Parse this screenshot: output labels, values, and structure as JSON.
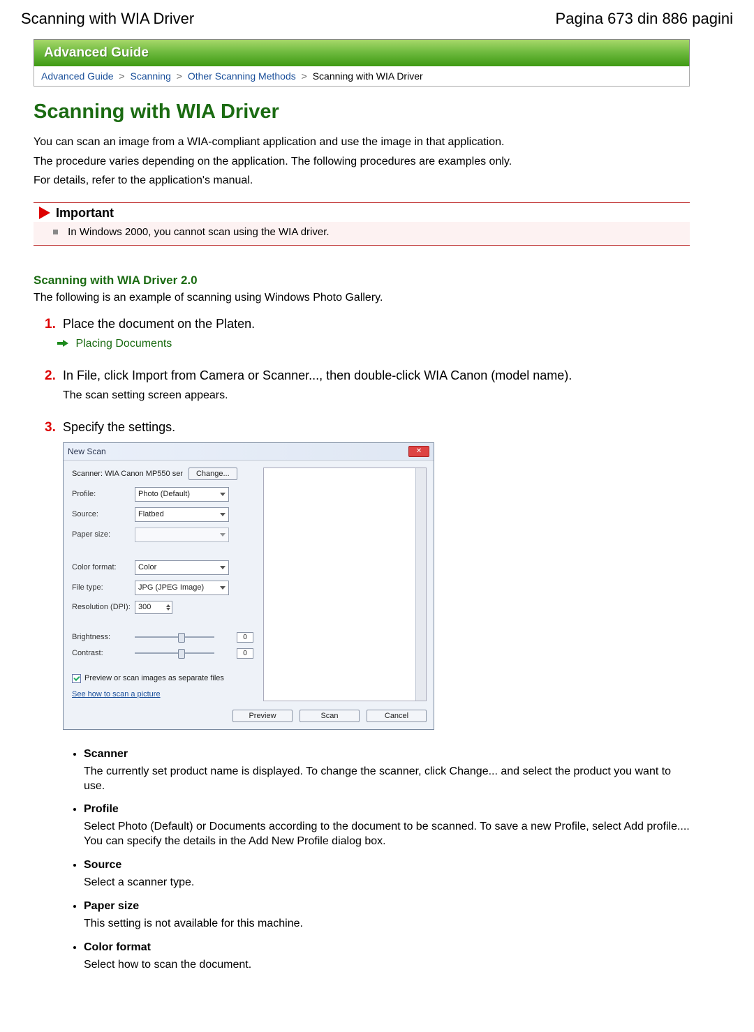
{
  "header": {
    "left": "Scanning with WIA Driver",
    "right": "Pagina 673 din 886 pagini"
  },
  "guide_bar": "Advanced Guide",
  "breadcrumb": {
    "items": [
      "Advanced Guide",
      "Scanning",
      "Other Scanning Methods"
    ],
    "current": "Scanning with WIA Driver",
    "sep": ">"
  },
  "title": "Scanning with WIA Driver",
  "intro": [
    "You can scan an image from a WIA-compliant application and use the image in that application.",
    "The procedure varies depending on the application. The following procedures are examples only.",
    "For details, refer to the application's manual."
  ],
  "important": {
    "heading": "Important",
    "text": "In Windows 2000, you cannot scan using the WIA driver."
  },
  "section": {
    "heading": "Scanning with WIA Driver 2.0",
    "text": "The following is an example of scanning using Windows Photo Gallery."
  },
  "steps": [
    {
      "num": "1.",
      "text": "Place the document on the Platen.",
      "link": "Placing Documents"
    },
    {
      "num": "2.",
      "text": "In File, click Import from Camera or Scanner..., then double-click WIA Canon (model name).",
      "sub": "The scan setting screen appears."
    },
    {
      "num": "3.",
      "text": "Specify the settings."
    }
  ],
  "dialog": {
    "title": "New Scan",
    "scanner_label": "Scanner: WIA Canon MP550 ser",
    "change": "Change...",
    "rows": {
      "profile": {
        "label": "Profile:",
        "value": "Photo (Default)"
      },
      "source": {
        "label": "Source:",
        "value": "Flatbed"
      },
      "paper": {
        "label": "Paper size:",
        "value": ""
      },
      "color": {
        "label": "Color format:",
        "value": "Color"
      },
      "file": {
        "label": "File type:",
        "value": "JPG (JPEG Image)"
      },
      "res": {
        "label": "Resolution (DPI):",
        "value": "300"
      },
      "bright": {
        "label": "Brightness:",
        "value": "0"
      },
      "contrast": {
        "label": "Contrast:",
        "value": "0"
      }
    },
    "checkbox": "Preview or scan images as separate files",
    "help_link": "See how to scan a picture",
    "buttons": {
      "preview": "Preview",
      "scan": "Scan",
      "cancel": "Cancel"
    }
  },
  "defs": [
    {
      "term": "Scanner",
      "desc": "The currently set product name is displayed. To change the scanner, click Change... and select the product you want to use."
    },
    {
      "term": "Profile",
      "desc": "Select Photo (Default) or Documents according to the document to be scanned. To save a new Profile, select Add profile.... You can specify the details in the Add New Profile dialog box."
    },
    {
      "term": "Source",
      "desc": "Select a scanner type."
    },
    {
      "term": "Paper size",
      "desc": "This setting is not available for this machine."
    },
    {
      "term": "Color format",
      "desc": "Select how to scan the document."
    }
  ]
}
